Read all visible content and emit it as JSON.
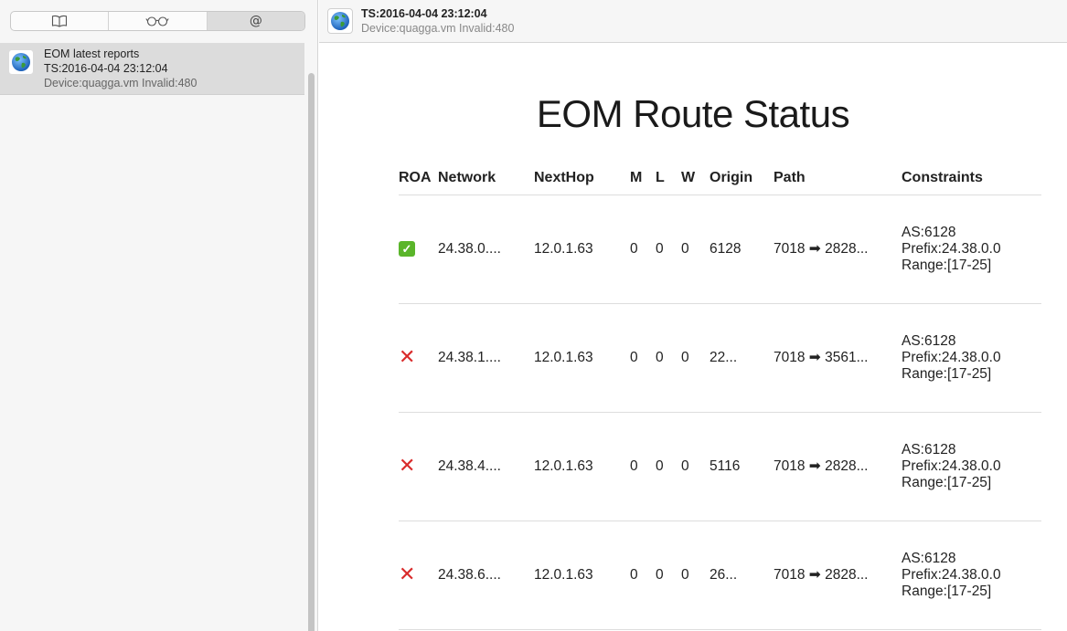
{
  "sidebar": {
    "tabs": [
      {
        "icon": "book-icon"
      },
      {
        "icon": "glasses-icon"
      },
      {
        "label": "@"
      }
    ],
    "items": [
      {
        "title": "EOM latest reports",
        "ts": "TS:2016-04-04 23:12:04",
        "device": "Device:quagga.vm Invalid:480",
        "icon": "globe-icon"
      }
    ]
  },
  "header": {
    "ts": "TS:2016-04-04 23:12:04",
    "device": "Device:quagga.vm Invalid:480",
    "icon": "globe-icon"
  },
  "main": {
    "title": "EOM Route Status",
    "columns": [
      "ROA",
      "Network",
      "NextHop",
      "M",
      "L",
      "W",
      "Origin",
      "Path",
      "Constraints"
    ],
    "rows": [
      {
        "roa": "valid",
        "network": "24.38.0....",
        "nexthop": "12.0.1.63",
        "m": "0",
        "l": "0",
        "w": "0",
        "origin": "6128",
        "path": "7018 ➡ 2828...",
        "c_as": "AS:6128",
        "c_prefix": "Prefix:24.38.0.0",
        "c_range": "Range:[17-25]"
      },
      {
        "roa": "invalid",
        "network": "24.38.1....",
        "nexthop": "12.0.1.63",
        "m": "0",
        "l": "0",
        "w": "0",
        "origin": "22...",
        "path": "7018 ➡ 3561...",
        "c_as": "AS:6128",
        "c_prefix": "Prefix:24.38.0.0",
        "c_range": "Range:[17-25]"
      },
      {
        "roa": "invalid",
        "network": "24.38.4....",
        "nexthop": "12.0.1.63",
        "m": "0",
        "l": "0",
        "w": "0",
        "origin": "5116",
        "path": "7018 ➡ 2828...",
        "c_as": "AS:6128",
        "c_prefix": "Prefix:24.38.0.0",
        "c_range": "Range:[17-25]"
      },
      {
        "roa": "invalid",
        "network": "24.38.6....",
        "nexthop": "12.0.1.63",
        "m": "0",
        "l": "0",
        "w": "0",
        "origin": "26...",
        "path": "7018 ➡ 2828...",
        "c_as": "AS:6128",
        "c_prefix": "Prefix:24.38.0.0",
        "c_range": "Range:[17-25]"
      }
    ],
    "roa_symbols": {
      "valid": "✓",
      "invalid": "✕"
    },
    "colors": {
      "valid": "#5ab52a",
      "invalid": "#d92b2b"
    }
  }
}
